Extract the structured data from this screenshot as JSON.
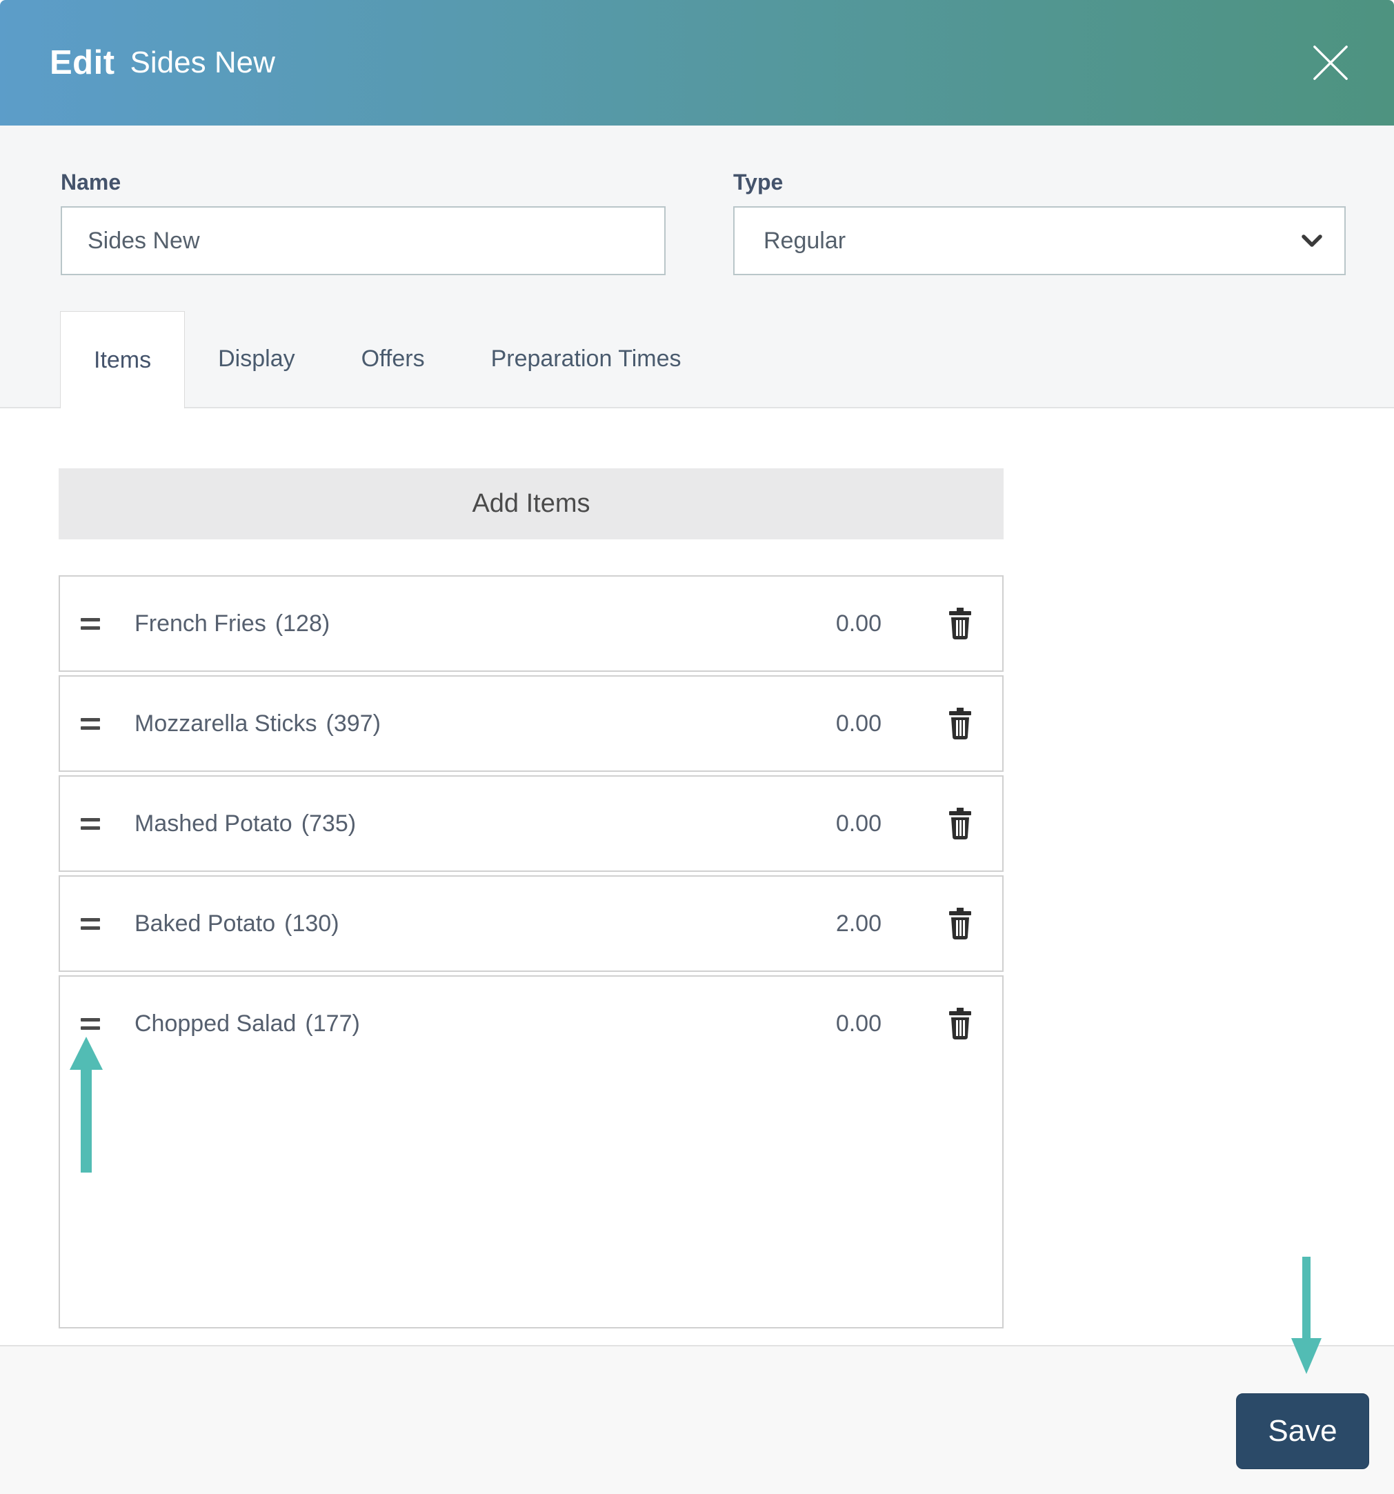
{
  "colors": {
    "header_gradient_start": "#5C9DC9",
    "header_gradient_end": "#4E9380",
    "accent_teal": "#52BCB4",
    "save_button_navy": "#2B4A68",
    "field_border": "#B9C6C9"
  },
  "header": {
    "title_prefix": "Edit",
    "title": "Sides New"
  },
  "form": {
    "name_label": "Name",
    "name_value": "Sides New",
    "type_label": "Type",
    "type_value": "Regular"
  },
  "tabs": [
    {
      "label": "Items"
    },
    {
      "label": "Display"
    },
    {
      "label": "Offers"
    },
    {
      "label": "Preparation Times"
    }
  ],
  "items_section": {
    "add_button_label": "Add Items",
    "items": [
      {
        "name": "French Fries",
        "code": "(128)",
        "price": "0.00"
      },
      {
        "name": "Mozzarella Sticks",
        "code": "(397)",
        "price": "0.00"
      },
      {
        "name": "Mashed Potato",
        "code": "(735)",
        "price": "0.00"
      },
      {
        "name": "Baked Potato",
        "code": "(130)",
        "price": "2.00"
      },
      {
        "name": "Chopped Salad",
        "code": "(177)",
        "price": "0.00"
      }
    ]
  },
  "footer": {
    "save_label": "Save"
  }
}
